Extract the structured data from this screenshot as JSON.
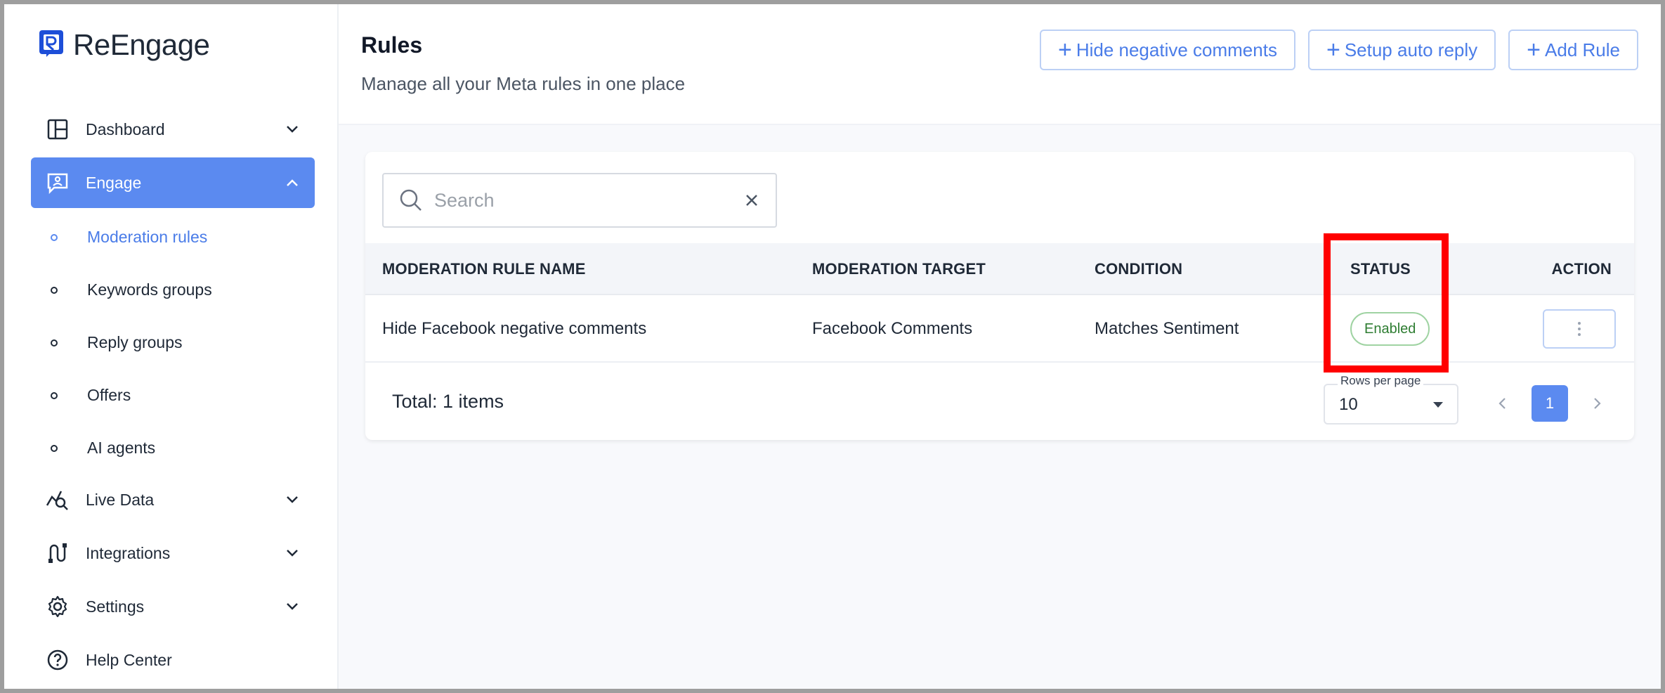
{
  "brand": {
    "name": "ReEngage"
  },
  "sidebar": {
    "items": [
      {
        "label": "Dashboard",
        "icon": "dashboard-icon"
      },
      {
        "label": "Engage",
        "icon": "engage-icon",
        "active": true
      },
      {
        "label": "Live Data",
        "icon": "live-data-icon"
      },
      {
        "label": "Integrations",
        "icon": "integrations-icon"
      },
      {
        "label": "Settings",
        "icon": "gear-icon"
      },
      {
        "label": "Help Center",
        "icon": "help-icon"
      }
    ],
    "engage_sub": [
      {
        "label": "Moderation rules",
        "active": true
      },
      {
        "label": "Keywords groups"
      },
      {
        "label": "Reply groups"
      },
      {
        "label": "Offers"
      },
      {
        "label": "AI agents"
      }
    ]
  },
  "header": {
    "title": "Rules",
    "subtitle": "Manage all your Meta rules in one place",
    "actions": {
      "hide_negative": "Hide negative comments",
      "setup_auto_reply": "Setup auto reply",
      "add_rule": "Add Rule"
    }
  },
  "search": {
    "placeholder": "Search",
    "value": ""
  },
  "table": {
    "columns": {
      "name": "MODERATION RULE NAME",
      "target": "MODERATION TARGET",
      "condition": "CONDITION",
      "status": "STATUS",
      "action": "ACTION"
    },
    "rows": [
      {
        "name": "Hide Facebook negative comments",
        "target": "Facebook Comments",
        "condition": "Matches Sentiment",
        "status": "Enabled"
      }
    ]
  },
  "footer": {
    "total": "Total: 1 items",
    "rows_per_page_label": "Rows per page",
    "rows_per_page_value": "10",
    "current_page": "1"
  },
  "colors": {
    "accent": "#5b8af0",
    "status_enabled": "#2e7d32",
    "highlight": "#ff0000"
  }
}
